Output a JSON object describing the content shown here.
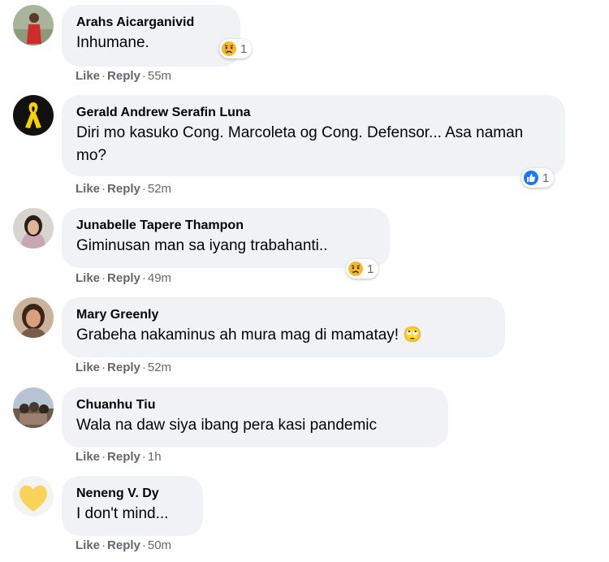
{
  "comments": [
    {
      "author": "Arahs Aicarganivid",
      "text": "Inhumane.",
      "reaction": {
        "icon": "sad-icon",
        "count": "1"
      },
      "like": "Like",
      "reply": "Reply",
      "time": "55m"
    },
    {
      "author": "Gerald Andrew Serafin Luna",
      "text": "Diri mo kasuko Cong. Marcoleta og Cong. Defensor... Asa naman mo?",
      "reaction": {
        "icon": "like-icon",
        "count": "1"
      },
      "like": "Like",
      "reply": "Reply",
      "time": "52m"
    },
    {
      "author": "Junabelle Tapere Thampon",
      "text": "Giminusan man sa iyang trabahanti..",
      "reaction": {
        "icon": "sad-icon",
        "count": "1"
      },
      "like": "Like",
      "reply": "Reply",
      "time": "49m"
    },
    {
      "author": "Mary Greenly",
      "text": "Grabeha nakaminus ah mura mag di mamatay! 🙄",
      "like": "Like",
      "reply": "Reply",
      "time": "52m"
    },
    {
      "author": "Chuanhu Tiu",
      "text": "Wala na daw siya ibang pera kasi pandemic",
      "like": "Like",
      "reply": "Reply",
      "time": "1h"
    },
    {
      "author": "Neneng V. Dy",
      "text": "I don't mind...",
      "like": "Like",
      "reply": "Reply",
      "time": "50m"
    }
  ],
  "separator": "·",
  "colors": {
    "bubble": "#f0f2f5",
    "meta_text": "#65676b",
    "like_blue": "#1877f2",
    "sad_yellow": "#f7b928"
  }
}
